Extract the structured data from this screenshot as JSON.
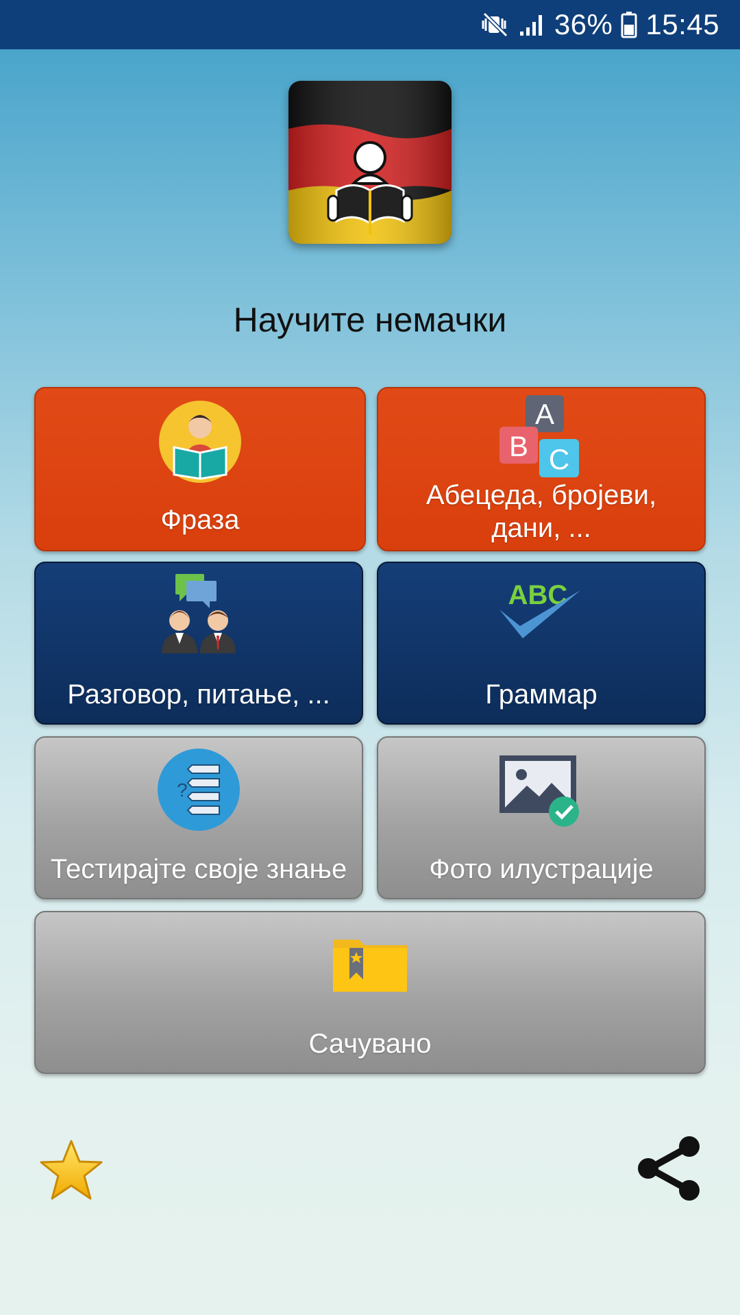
{
  "status_bar": {
    "battery": "36%",
    "time": "15:45",
    "icons": [
      "mute-vibrate-icon",
      "signal-icon",
      "battery-icon"
    ]
  },
  "app": {
    "title": "Научите немачки",
    "logo_icon": "german-flag-reader-icon"
  },
  "menu": {
    "phrases": {
      "label": "Фраза",
      "icon": "reading-person-icon",
      "color": "#dd4510"
    },
    "alphabet": {
      "label_line1": "Абецеда, бројеви,",
      "label_line2": "дани, ...",
      "icon": "abc-blocks-icon",
      "color": "#dd4510"
    },
    "conversation": {
      "label": "Разговор, питање, ...",
      "icon": "conversation-people-icon",
      "color": "#123a70"
    },
    "grammar": {
      "label": "Граммар",
      "icon_text": "ABC",
      "icon": "abc-checkmark-icon",
      "color": "#123a70"
    },
    "test": {
      "label": "Тестирајте своје знање",
      "icon": "quiz-icon",
      "color": "#a8a8a8"
    },
    "photos": {
      "label": "Фото илустрације",
      "icon": "photo-check-icon",
      "color": "#a8a8a8"
    },
    "saved": {
      "label": "Сачувано",
      "icon": "bookmark-folder-icon",
      "color": "#a8a8a8"
    }
  },
  "bottom": {
    "rate_icon": "star-icon",
    "share_icon": "share-icon"
  }
}
